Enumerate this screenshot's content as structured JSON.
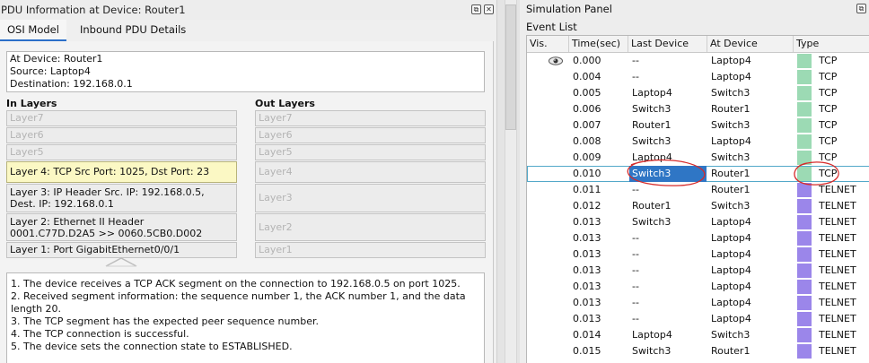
{
  "pdu_window": {
    "title": "PDU Information at Device: Router1",
    "tabs": [
      {
        "label": "OSI Model",
        "active": true
      },
      {
        "label": "Inbound PDU Details",
        "active": false
      }
    ],
    "info": {
      "at_device": "At Device: Router1",
      "source": "Source: Laptop4",
      "destination": "Destination: 192.168.0.1"
    },
    "in_layers_header": "In Layers",
    "out_layers_header": "Out Layers",
    "in_layers": [
      {
        "l1": "Layer7",
        "l2": "",
        "state": "off"
      },
      {
        "l1": "Layer6",
        "l2": "",
        "state": "off"
      },
      {
        "l1": "Layer5",
        "l2": "",
        "state": "off"
      },
      {
        "l1": "Layer 4: TCP Src Port: 1025, Dst Port: 23",
        "l2": "",
        "state": "selected"
      },
      {
        "l1": "Layer 3: IP Header Src. IP: 192.168.0.5,",
        "l2": "Dest. IP: 192.168.0.1",
        "state": "on"
      },
      {
        "l1": "Layer 2: Ethernet II Header",
        "l2": "0001.C77D.D2A5 >> 0060.5CB0.D002",
        "state": "on"
      },
      {
        "l1": "Layer 1: Port GigabitEthernet0/0/1",
        "l2": "",
        "state": "on"
      }
    ],
    "out_layers": [
      "Layer7",
      "Layer6",
      "Layer5",
      "Layer4",
      "Layer3",
      "Layer2",
      "Layer1"
    ],
    "description": [
      "1. The device receives a TCP ACK segment on the connection to 192.168.0.5 on port 1025.",
      "2. Received segment information: the sequence number 1, the ACK number 1, and the data",
      "length 20.",
      "3. The TCP segment has the expected peer sequence number.",
      "4. The TCP connection is successful.",
      "5. The device sets the connection state to ESTABLISHED."
    ]
  },
  "simulation_panel": {
    "title": "Simulation Panel",
    "event_list_label": "Event List",
    "columns": [
      "Vis.",
      "Time(sec)",
      "Last Device",
      "At Device",
      "Type"
    ],
    "colors": {
      "tcp": "#9cdab4",
      "telnet": "#9b86ea",
      "selection": "#2f76c5",
      "row_outline": "#53a8c9",
      "annotation": "#d62a2a"
    },
    "rows": [
      {
        "vis": "eye-icon",
        "time": "0.000",
        "last": "--",
        "at": "Laptop4",
        "type": "TCP",
        "color": "#9cdab4"
      },
      {
        "vis": "",
        "time": "0.004",
        "last": "--",
        "at": "Laptop4",
        "type": "TCP",
        "color": "#9cdab4"
      },
      {
        "vis": "",
        "time": "0.005",
        "last": "Laptop4",
        "at": "Switch3",
        "type": "TCP",
        "color": "#9cdab4"
      },
      {
        "vis": "",
        "time": "0.006",
        "last": "Switch3",
        "at": "Router1",
        "type": "TCP",
        "color": "#9cdab4"
      },
      {
        "vis": "",
        "time": "0.007",
        "last": "Router1",
        "at": "Switch3",
        "type": "TCP",
        "color": "#9cdab4"
      },
      {
        "vis": "",
        "time": "0.008",
        "last": "Switch3",
        "at": "Laptop4",
        "type": "TCP",
        "color": "#9cdab4"
      },
      {
        "vis": "",
        "time": "0.009",
        "last": "Laptop4",
        "at": "Switch3",
        "type": "TCP",
        "color": "#9cdab4"
      },
      {
        "vis": "",
        "time": "0.010",
        "last": "Switch3",
        "at": "Router1",
        "type": "TCP",
        "color": "#9cdab4",
        "selected": true
      },
      {
        "vis": "",
        "time": "0.011",
        "last": "--",
        "at": "Router1",
        "type": "TELNET",
        "color": "#9b86ea"
      },
      {
        "vis": "",
        "time": "0.012",
        "last": "Router1",
        "at": "Switch3",
        "type": "TELNET",
        "color": "#9b86ea"
      },
      {
        "vis": "",
        "time": "0.013",
        "last": "Switch3",
        "at": "Laptop4",
        "type": "TELNET",
        "color": "#9b86ea"
      },
      {
        "vis": "",
        "time": "0.013",
        "last": "--",
        "at": "Laptop4",
        "type": "TELNET",
        "color": "#9b86ea"
      },
      {
        "vis": "",
        "time": "0.013",
        "last": "--",
        "at": "Laptop4",
        "type": "TELNET",
        "color": "#9b86ea"
      },
      {
        "vis": "",
        "time": "0.013",
        "last": "--",
        "at": "Laptop4",
        "type": "TELNET",
        "color": "#9b86ea"
      },
      {
        "vis": "",
        "time": "0.013",
        "last": "--",
        "at": "Laptop4",
        "type": "TELNET",
        "color": "#9b86ea"
      },
      {
        "vis": "",
        "time": "0.013",
        "last": "--",
        "at": "Laptop4",
        "type": "TELNET",
        "color": "#9b86ea"
      },
      {
        "vis": "",
        "time": "0.013",
        "last": "--",
        "at": "Laptop4",
        "type": "TELNET",
        "color": "#9b86ea"
      },
      {
        "vis": "",
        "time": "0.014",
        "last": "Laptop4",
        "at": "Switch3",
        "type": "TELNET",
        "color": "#9b86ea"
      },
      {
        "vis": "",
        "time": "0.015",
        "last": "Switch3",
        "at": "Router1",
        "type": "TELNET",
        "color": "#9b86ea"
      }
    ]
  }
}
